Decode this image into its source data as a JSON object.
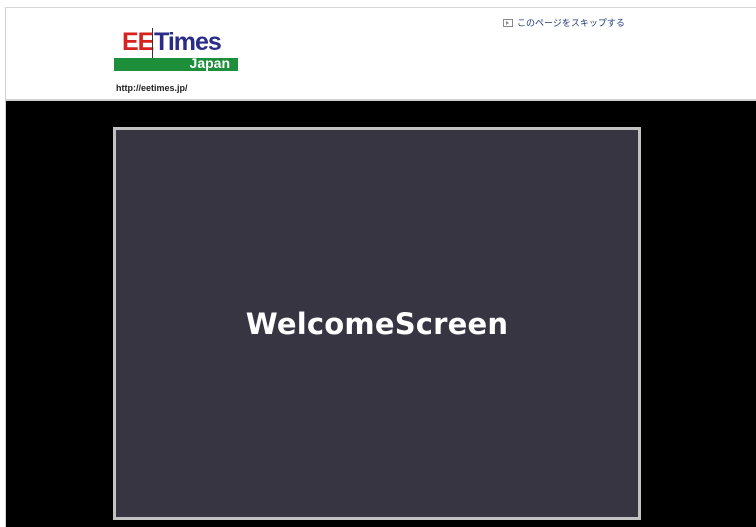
{
  "header": {
    "logo": {
      "part1": "EE",
      "part2": "Times",
      "part3": "Japan"
    },
    "url": "http://eetimes.jp/",
    "skip_link": {
      "icon": "skip-icon",
      "label": "このページをスキップする"
    }
  },
  "main": {
    "welcome_label": "WelcomeScreen"
  },
  "colors": {
    "logo_red": "#d6231f",
    "logo_blue": "#2b2b88",
    "logo_green": "#1d8f3a",
    "stage_bg": "#383543",
    "page_bg": "#000000"
  }
}
